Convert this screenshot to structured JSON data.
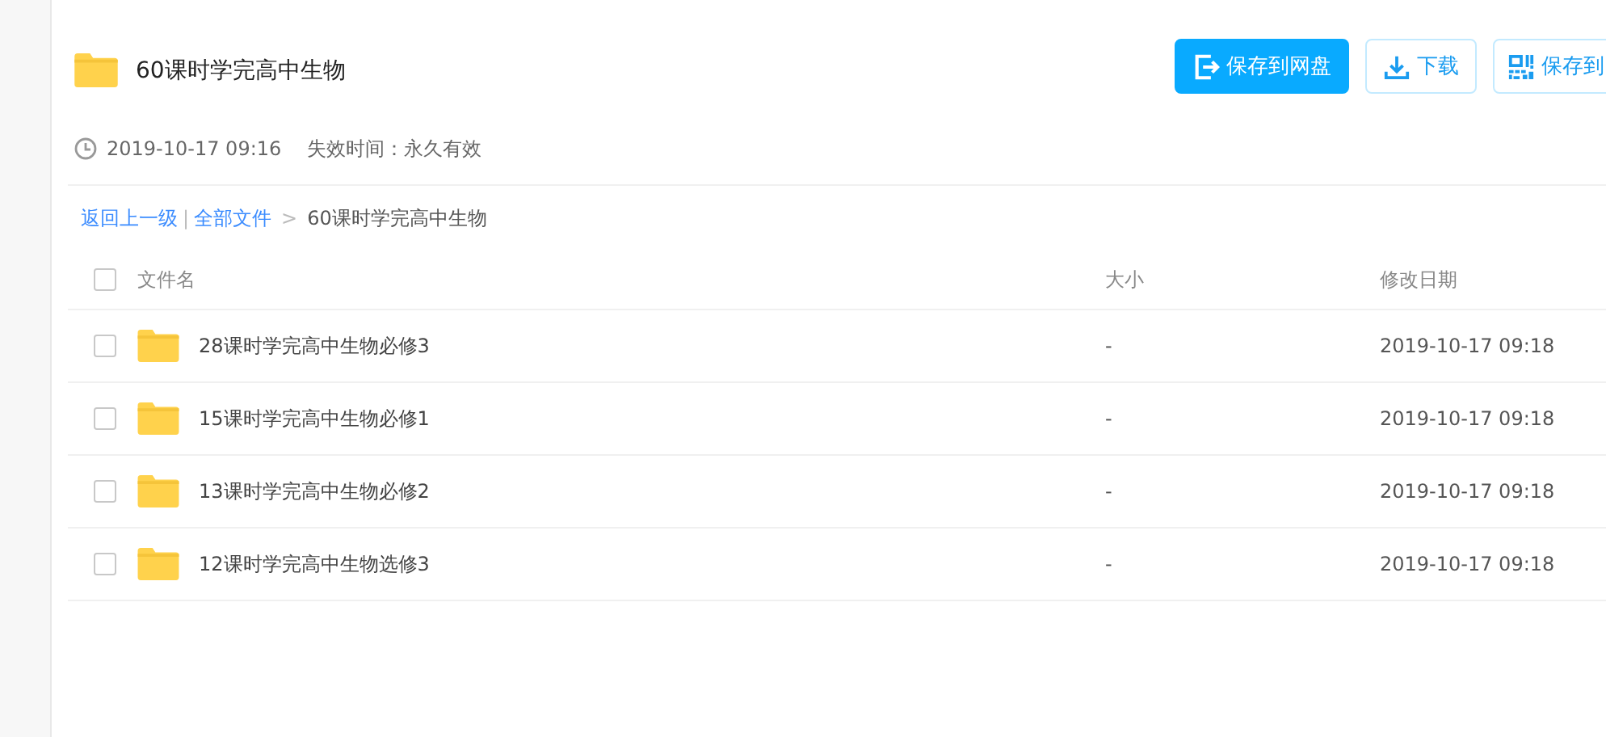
{
  "header": {
    "title": "60课时学完高中生物",
    "buttons": [
      {
        "kind": "save",
        "label": "保存到网盘"
      },
      {
        "kind": "download",
        "label": "下载"
      },
      {
        "kind": "qr",
        "label": "保存到"
      }
    ],
    "time": "2019-10-17 09:16",
    "expiry": "失效时间：永久有效"
  },
  "breadcrumb": {
    "back": "返回上一级",
    "separator": "|",
    "root": "全部文件",
    "arrow": ">",
    "current": "60课时学完高中生物"
  },
  "table": {
    "columns": [
      "文件名",
      "大小",
      "修改日期"
    ],
    "all_checked": false,
    "rows": [
      {
        "name": "28课时学完高中生物必修3",
        "size": "-",
        "date": "2019-10-17 09:18",
        "checked": false
      },
      {
        "name": "15课时学完高中生物必修1",
        "size": "-",
        "date": "2019-10-17 09:18",
        "checked": false
      },
      {
        "name": "13课时学完高中生物必修2",
        "size": "-",
        "date": "2019-10-17 09:18",
        "checked": false
      },
      {
        "name": "12课时学完高中生物选修3",
        "size": "-",
        "date": "2019-10-17 09:18",
        "checked": false
      }
    ]
  }
}
